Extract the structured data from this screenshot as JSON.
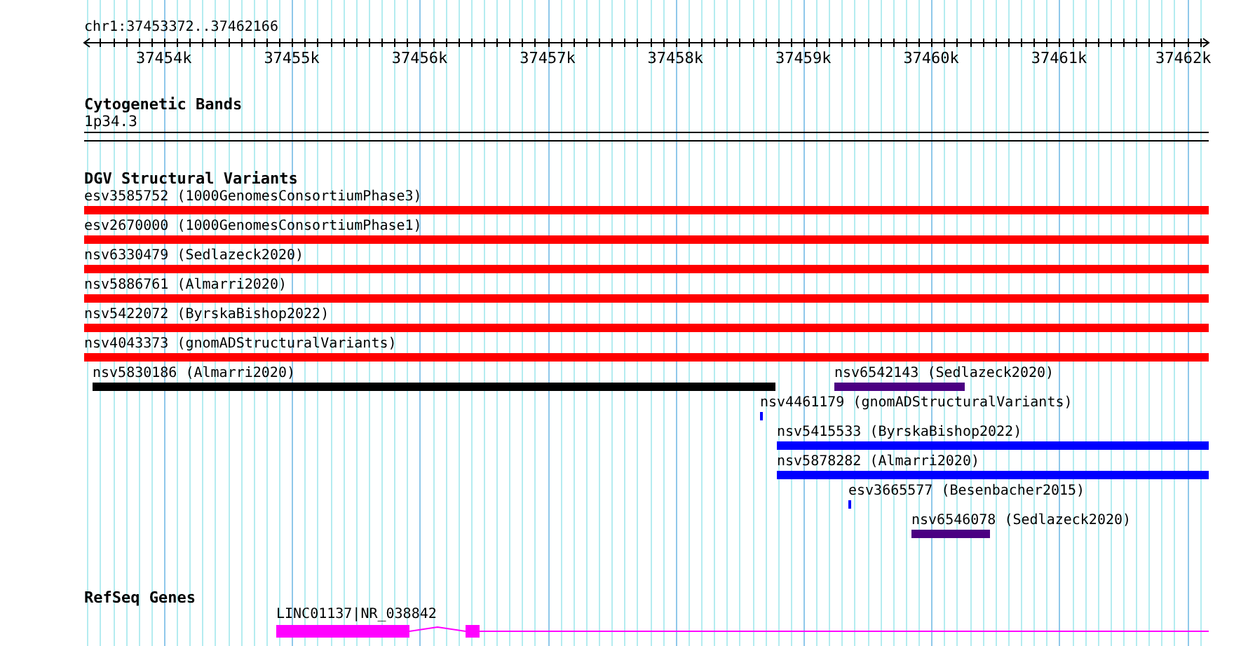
{
  "view": {
    "location": "chr1:37453372..37462166"
  },
  "ruler": {
    "ticks": [
      "37454k",
      "37455k",
      "37456k",
      "37457k",
      "37458k",
      "37459k",
      "37460k",
      "37461k",
      "37462k"
    ]
  },
  "tracks": [
    {
      "kind": "bands",
      "title": "Cytogenetic Bands",
      "band": "1p34.3"
    },
    {
      "kind": "variants",
      "title": "DGV Structural Variants",
      "rows": [
        {
          "features": [
            {
              "label": "esv3585752 (1000GenomesConsortiumPhase3)",
              "color": "#ff0000"
            }
          ]
        },
        {
          "features": [
            {
              "label": "esv2670000 (1000GenomesConsortiumPhase1)",
              "color": "#ff0000"
            }
          ]
        },
        {
          "features": [
            {
              "label": "nsv6330479 (Sedlazeck2020)",
              "color": "#ff0000"
            }
          ]
        },
        {
          "features": [
            {
              "label": "nsv5886761 (Almarri2020)",
              "color": "#ff0000"
            }
          ]
        },
        {
          "features": [
            {
              "label": "nsv5422072 (ByrskaBishop2022)",
              "color": "#ff0000"
            }
          ]
        },
        {
          "features": [
            {
              "label": "nsv4043373 (gnomADStructuralVariants)",
              "color": "#ff0000"
            }
          ]
        },
        {
          "features": [
            {
              "label": "nsv5830186 (Almarri2020)",
              "color": "#000000"
            },
            {
              "label": "nsv6542143 (Sedlazeck2020)",
              "color": "#4b0082"
            }
          ]
        },
        {
          "features": [
            {
              "label": "nsv4461179 (gnomADStructuralVariants)",
              "color": "#0000ff"
            }
          ]
        },
        {
          "features": [
            {
              "label": "nsv5415533 (ByrskaBishop2022)",
              "color": "#0000ff"
            }
          ]
        },
        {
          "features": [
            {
              "label": "nsv5878282 (Almarri2020)",
              "color": "#0000ff"
            }
          ]
        },
        {
          "features": [
            {
              "label": "esv3665577 (Besenbacher2015)",
              "color": "#0000ff"
            }
          ]
        },
        {
          "features": [
            {
              "label": "nsv6546078 (Sedlazeck2020)",
              "color": "#4b0082"
            }
          ]
        }
      ]
    },
    {
      "kind": "genes",
      "title": "RefSeq Genes",
      "genes": [
        {
          "label": "LINC01137|NR_038842",
          "color": "#ff00ff"
        }
      ]
    }
  ]
}
